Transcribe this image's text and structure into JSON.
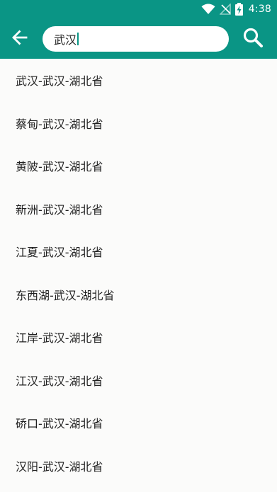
{
  "status_bar": {
    "time": "4:38",
    "icons": [
      "wifi-icon",
      "no-signal-icon",
      "battery-charging-icon"
    ]
  },
  "app_bar": {
    "back_icon": "arrow-left-icon",
    "search_icon": "search-icon",
    "accent_color": "#0a9585"
  },
  "search": {
    "value": "武汉"
  },
  "results": [
    "武汉-武汉-湖北省",
    "蔡甸-武汉-湖北省",
    "黄陂-武汉-湖北省",
    "新洲-武汉-湖北省",
    "江夏-武汉-湖北省",
    "东西湖-武汉-湖北省",
    "江岸-武汉-湖北省",
    "江汉-武汉-湖北省",
    "硚口-武汉-湖北省",
    "汉阳-武汉-湖北省"
  ]
}
